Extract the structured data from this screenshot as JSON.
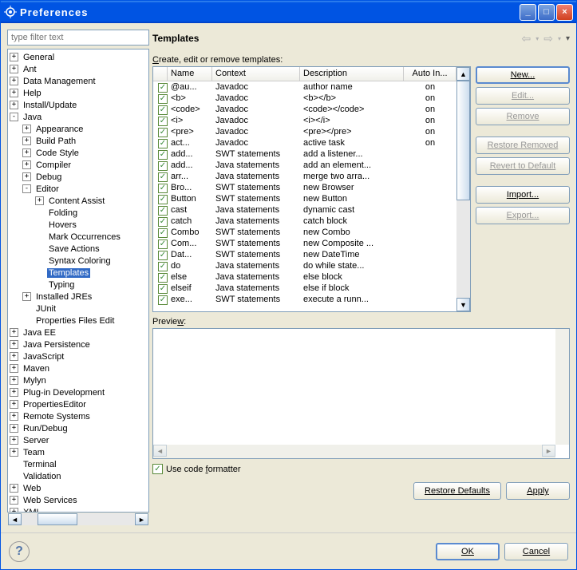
{
  "window": {
    "title": "Preferences"
  },
  "filter": {
    "placeholder": "type filter text"
  },
  "tree": [
    {
      "label": "General",
      "depth": 0,
      "toggle": "+"
    },
    {
      "label": "Ant",
      "depth": 0,
      "toggle": "+"
    },
    {
      "label": "Data Management",
      "depth": 0,
      "toggle": "+"
    },
    {
      "label": "Help",
      "depth": 0,
      "toggle": "+"
    },
    {
      "label": "Install/Update",
      "depth": 0,
      "toggle": "+"
    },
    {
      "label": "Java",
      "depth": 0,
      "toggle": "-"
    },
    {
      "label": "Appearance",
      "depth": 1,
      "toggle": "+"
    },
    {
      "label": "Build Path",
      "depth": 1,
      "toggle": "+"
    },
    {
      "label": "Code Style",
      "depth": 1,
      "toggle": "+"
    },
    {
      "label": "Compiler",
      "depth": 1,
      "toggle": "+"
    },
    {
      "label": "Debug",
      "depth": 1,
      "toggle": "+"
    },
    {
      "label": "Editor",
      "depth": 1,
      "toggle": "-"
    },
    {
      "label": "Content Assist",
      "depth": 2,
      "toggle": "+"
    },
    {
      "label": "Folding",
      "depth": 2,
      "toggle": ""
    },
    {
      "label": "Hovers",
      "depth": 2,
      "toggle": ""
    },
    {
      "label": "Mark Occurrences",
      "depth": 2,
      "toggle": ""
    },
    {
      "label": "Save Actions",
      "depth": 2,
      "toggle": ""
    },
    {
      "label": "Syntax Coloring",
      "depth": 2,
      "toggle": ""
    },
    {
      "label": "Templates",
      "depth": 2,
      "toggle": "",
      "selected": true
    },
    {
      "label": "Typing",
      "depth": 2,
      "toggle": ""
    },
    {
      "label": "Installed JREs",
      "depth": 1,
      "toggle": "+"
    },
    {
      "label": "JUnit",
      "depth": 1,
      "toggle": ""
    },
    {
      "label": "Properties Files Edit",
      "depth": 1,
      "toggle": ""
    },
    {
      "label": "Java EE",
      "depth": 0,
      "toggle": "+"
    },
    {
      "label": "Java Persistence",
      "depth": 0,
      "toggle": "+"
    },
    {
      "label": "JavaScript",
      "depth": 0,
      "toggle": "+"
    },
    {
      "label": "Maven",
      "depth": 0,
      "toggle": "+"
    },
    {
      "label": "Mylyn",
      "depth": 0,
      "toggle": "+"
    },
    {
      "label": "Plug-in Development",
      "depth": 0,
      "toggle": "+"
    },
    {
      "label": "PropertiesEditor",
      "depth": 0,
      "toggle": "+"
    },
    {
      "label": "Remote Systems",
      "depth": 0,
      "toggle": "+"
    },
    {
      "label": "Run/Debug",
      "depth": 0,
      "toggle": "+"
    },
    {
      "label": "Server",
      "depth": 0,
      "toggle": "+"
    },
    {
      "label": "Team",
      "depth": 0,
      "toggle": "+"
    },
    {
      "label": "Terminal",
      "depth": 0,
      "toggle": ""
    },
    {
      "label": "Validation",
      "depth": 0,
      "toggle": ""
    },
    {
      "label": "Web",
      "depth": 0,
      "toggle": "+"
    },
    {
      "label": "Web Services",
      "depth": 0,
      "toggle": "+"
    },
    {
      "label": "XML",
      "depth": 0,
      "toggle": "+"
    }
  ],
  "page": {
    "title": "Templates",
    "subtitle_pre": "C",
    "subtitle_rest": "reate, edit or remove templates:",
    "preview_label_pre": "Previe",
    "preview_label_ul": "w",
    "preview_label_post": ":",
    "formatter_pre": "Use code ",
    "formatter_ul": "f",
    "formatter_post": "ormatter"
  },
  "columns": {
    "name": "Name",
    "context": "Context",
    "desc": "Description",
    "auto": "Auto In..."
  },
  "rows": [
    {
      "name": "@au...",
      "context": "Javadoc",
      "desc": "author name",
      "auto": "on"
    },
    {
      "name": "<b>",
      "context": "Javadoc",
      "desc": "<b></b>",
      "auto": "on"
    },
    {
      "name": "<code>",
      "context": "Javadoc",
      "desc": "<code></code>",
      "auto": "on"
    },
    {
      "name": "<i>",
      "context": "Javadoc",
      "desc": "<i></i>",
      "auto": "on"
    },
    {
      "name": "<pre>",
      "context": "Javadoc",
      "desc": "<pre></pre>",
      "auto": "on"
    },
    {
      "name": "act...",
      "context": "Javadoc",
      "desc": "active task",
      "auto": "on"
    },
    {
      "name": "add...",
      "context": "SWT statements",
      "desc": "add a listener...",
      "auto": ""
    },
    {
      "name": "add...",
      "context": "Java statements",
      "desc": "add an element...",
      "auto": ""
    },
    {
      "name": "arr...",
      "context": "Java statements",
      "desc": "merge two arra...",
      "auto": ""
    },
    {
      "name": "Bro...",
      "context": "SWT statements",
      "desc": "new Browser",
      "auto": ""
    },
    {
      "name": "Button",
      "context": "SWT statements",
      "desc": "new Button",
      "auto": ""
    },
    {
      "name": "cast",
      "context": "Java statements",
      "desc": "dynamic cast",
      "auto": ""
    },
    {
      "name": "catch",
      "context": "Java statements",
      "desc": "catch block",
      "auto": ""
    },
    {
      "name": "Combo",
      "context": "SWT statements",
      "desc": "new Combo",
      "auto": ""
    },
    {
      "name": "Com...",
      "context": "SWT statements",
      "desc": "new Composite ...",
      "auto": ""
    },
    {
      "name": "Dat...",
      "context": "SWT statements",
      "desc": "new DateTime",
      "auto": ""
    },
    {
      "name": "do",
      "context": "Java statements",
      "desc": "do while state...",
      "auto": ""
    },
    {
      "name": "else",
      "context": "Java statements",
      "desc": "else block",
      "auto": ""
    },
    {
      "name": "elseif",
      "context": "Java statements",
      "desc": "else if block",
      "auto": ""
    },
    {
      "name": "exe...",
      "context": "SWT statements",
      "desc": "execute a runn...",
      "auto": ""
    }
  ],
  "buttons": {
    "new": "New...",
    "edit": "Edit...",
    "remove": "Remove",
    "restore_removed": "Restore Removed",
    "revert": "Revert to Default",
    "import": "Import...",
    "export": "Export...",
    "restore_defaults": "Restore Defaults",
    "apply": "Apply",
    "ok": "OK",
    "cancel": "Cancel"
  }
}
